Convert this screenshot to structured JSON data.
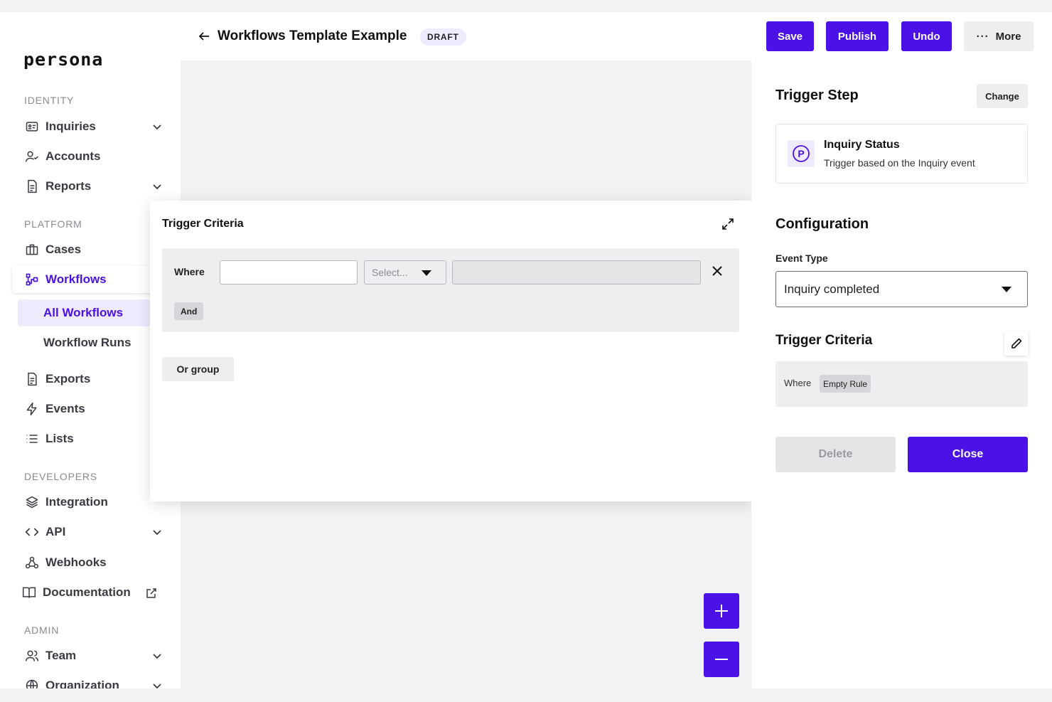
{
  "brand": {
    "logo_text": "persona",
    "accent": "#4b12e8"
  },
  "sidebar": {
    "sections": {
      "identity": "IDENTITY",
      "platform": "PLATFORM",
      "developers": "DEVELOPERS",
      "admin": "ADMIN"
    },
    "items": {
      "inquiries": {
        "label": "Inquiries",
        "icon": "id-card-icon",
        "expandable": true
      },
      "accounts": {
        "label": "Accounts",
        "icon": "user-check-icon"
      },
      "reports": {
        "label": "Reports",
        "icon": "document-icon",
        "expandable": true
      },
      "cases": {
        "label": "Cases",
        "icon": "briefcase-icon"
      },
      "workflows": {
        "label": "Workflows",
        "icon": "workflow-icon",
        "active": true
      },
      "all_workflows": {
        "label": "All Workflows",
        "active": true
      },
      "workflow_runs": {
        "label": "Workflow Runs"
      },
      "exports": {
        "label": "Exports",
        "icon": "document-icon"
      },
      "events": {
        "label": "Events",
        "icon": "lightning-icon"
      },
      "lists": {
        "label": "Lists",
        "icon": "list-icon"
      },
      "integration": {
        "label": "Integration",
        "icon": "layers-icon"
      },
      "api": {
        "label": "API",
        "icon": "code-icon",
        "expandable": true
      },
      "webhooks": {
        "label": "Webhooks",
        "icon": "webhook-icon"
      },
      "documentation": {
        "label": "Documentation",
        "icon": "book-icon",
        "external": true
      },
      "team": {
        "label": "Team",
        "icon": "users-icon",
        "expandable": true
      },
      "organization": {
        "label": "Organization",
        "icon": "globe-icon",
        "expandable": true
      }
    }
  },
  "header": {
    "title": "Workflows Template Example",
    "badge": "DRAFT",
    "buttons": {
      "save": "Save",
      "publish": "Publish",
      "undo": "Undo",
      "more": "More"
    }
  },
  "modal": {
    "title": "Trigger Criteria",
    "where_label": "Where",
    "input_value": "",
    "select_placeholder": "Select...",
    "and_label": "And",
    "or_group_label": "Or group"
  },
  "right_panel": {
    "trigger_step_title": "Trigger Step",
    "change_label": "Change",
    "trigger": {
      "name": "Inquiry Status",
      "description": "Trigger based on the Inquiry event",
      "icon_letter": "P"
    },
    "configuration_title": "Configuration",
    "event_type_label": "Event Type",
    "event_type_value": "Inquiry completed",
    "trigger_criteria_title": "Trigger Criteria",
    "criteria": {
      "where": "Where",
      "rule": "Empty Rule"
    },
    "delete_label": "Delete",
    "close_label": "Close"
  }
}
